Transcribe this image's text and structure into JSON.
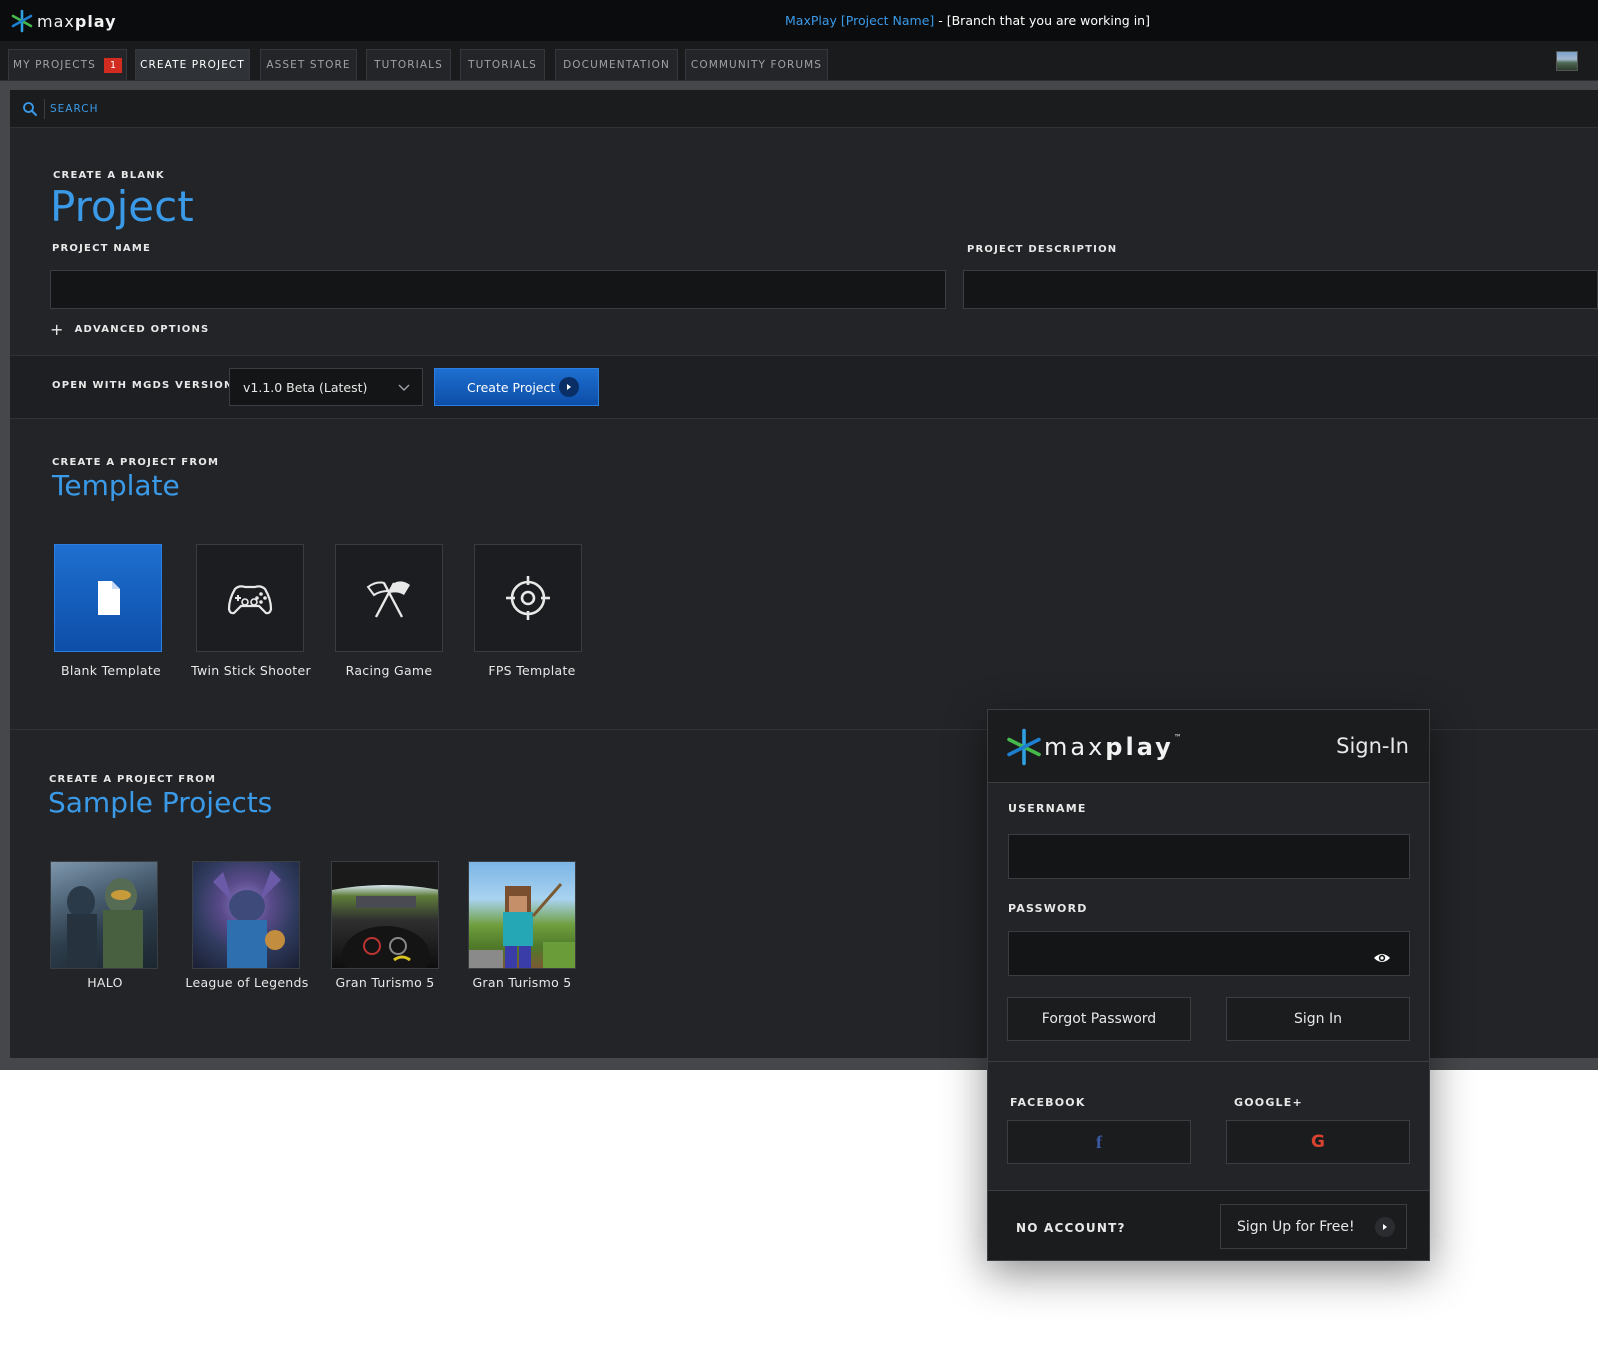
{
  "app": {
    "logo_text_regular": "max",
    "logo_text_bold": "play",
    "title_project": "MaxPlay [Project Name]",
    "title_branch": " - [Branch that you are working in]"
  },
  "tabs": [
    {
      "label": "MY PROJECTS",
      "badge": "1"
    },
    {
      "label": "CREATE PROJECT"
    },
    {
      "label": "ASSET STORE"
    },
    {
      "label": "TUTORIALS"
    },
    {
      "label": "TUTORIALS"
    },
    {
      "label": "DOCUMENTATION"
    },
    {
      "label": "COMMUNITY FORUMS"
    }
  ],
  "search": {
    "placeholder": "SEARCH"
  },
  "blank": {
    "eyebrow": "CREATE A BLANK",
    "title": "Project",
    "name_label": "PROJECT NAME",
    "name_value": "",
    "desc_label": "PROJECT DESCRIPTION",
    "desc_value": "",
    "advanced_label": "ADVANCED OPTIONS"
  },
  "version": {
    "label": "OPEN WITH MGDS VERSION",
    "selected": "v1.1.0 Beta (Latest)",
    "create_button": "Create Project"
  },
  "template_section": {
    "eyebrow": "CREATE A PROJECT FROM",
    "title": "Template",
    "items": [
      {
        "label": "Blank Template",
        "icon": "file-icon",
        "selected": true
      },
      {
        "label": "Twin Stick Shooter",
        "icon": "gamepad-icon"
      },
      {
        "label": "Racing Game",
        "icon": "racing-flags-icon"
      },
      {
        "label": "FPS Template",
        "icon": "crosshair-icon"
      }
    ]
  },
  "samples_section": {
    "eyebrow": "CREATE A PROJECT FROM",
    "title": "Sample Projects",
    "items": [
      {
        "label": "HALO"
      },
      {
        "label": "League of Legends"
      },
      {
        "label": "Gran Turismo 5"
      },
      {
        "label": "Gran Turismo 5"
      }
    ]
  },
  "signin": {
    "logo_regular": "max",
    "logo_bold": "play",
    "logo_tm": "™",
    "title": "Sign-In",
    "username_label": "USERNAME",
    "username_value": "",
    "password_label": "PASSWORD",
    "password_value": "",
    "forgot_button": "Forgot Password",
    "signin_button": "Sign In",
    "facebook_label": "FACEBOOK",
    "google_label": "GOOGLE+",
    "facebook_glyph": "f",
    "google_glyph": "G",
    "no_account": "NO ACCOUNT?",
    "signup_button": "Sign Up for Free!"
  },
  "colors": {
    "accent": "#3a9ae8",
    "primary_button": "#1e6fd0",
    "badge": "#d22b1f",
    "facebook": "#3b5aa6",
    "google": "#d8432f"
  }
}
